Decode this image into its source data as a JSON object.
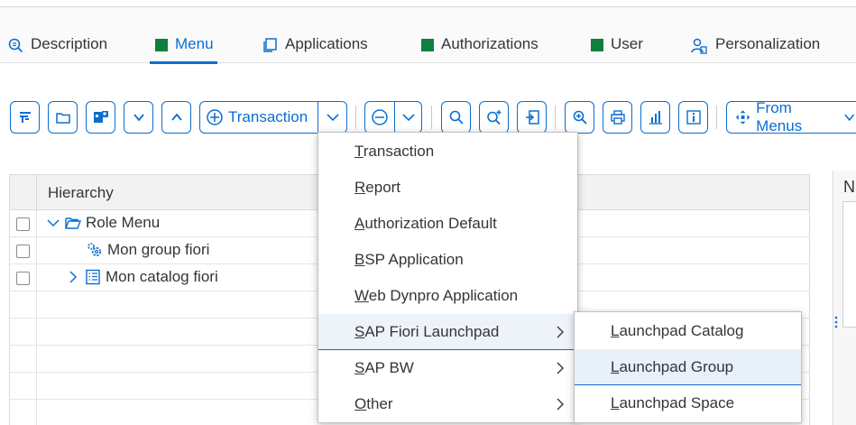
{
  "tabs": [
    {
      "label": "Description",
      "icon": "search-doc-icon"
    },
    {
      "label": "Menu",
      "icon": "green-square-icon",
      "active": true
    },
    {
      "label": "Applications",
      "icon": "copy-icon"
    },
    {
      "label": "Authorizations",
      "icon": "green-square-icon"
    },
    {
      "label": "User",
      "icon": "green-square-icon"
    },
    {
      "label": "Personalization",
      "icon": "person-settings-icon"
    }
  ],
  "toolbar": {
    "transaction_label": "Transaction",
    "from_menus_label": "From Menus"
  },
  "grid": {
    "header": "Hierarchy",
    "rows": [
      {
        "label": "Role Menu"
      },
      {
        "label": "Mon group fiori"
      },
      {
        "label": "Mon catalog fiori"
      }
    ]
  },
  "right_panel": {
    "letter": "N"
  },
  "menu": {
    "items": [
      {
        "mnemonic": "T",
        "rest": "ransaction"
      },
      {
        "mnemonic": "R",
        "rest": "eport"
      },
      {
        "mnemonic": "A",
        "rest": "uthorization Default"
      },
      {
        "mnemonic": "B",
        "rest": "SP Application"
      },
      {
        "mnemonic": "W",
        "rest": "eb Dynpro Application"
      },
      {
        "mnemonic": "S",
        "rest": "AP Fiori Launchpad"
      },
      {
        "mnemonic": "S",
        "rest": "AP BW"
      },
      {
        "mnemonic": "O",
        "rest": "ther"
      }
    ]
  },
  "submenu": {
    "items": [
      {
        "mnemonic": "L",
        "rest": "aunchpad Catalog"
      },
      {
        "mnemonic": "L",
        "rest": "aunchpad Group"
      },
      {
        "mnemonic": "L",
        "rest": "aunchpad Space"
      }
    ]
  },
  "colors": {
    "accent": "#0a6ed1",
    "tab_green": "#0f7f3f"
  }
}
